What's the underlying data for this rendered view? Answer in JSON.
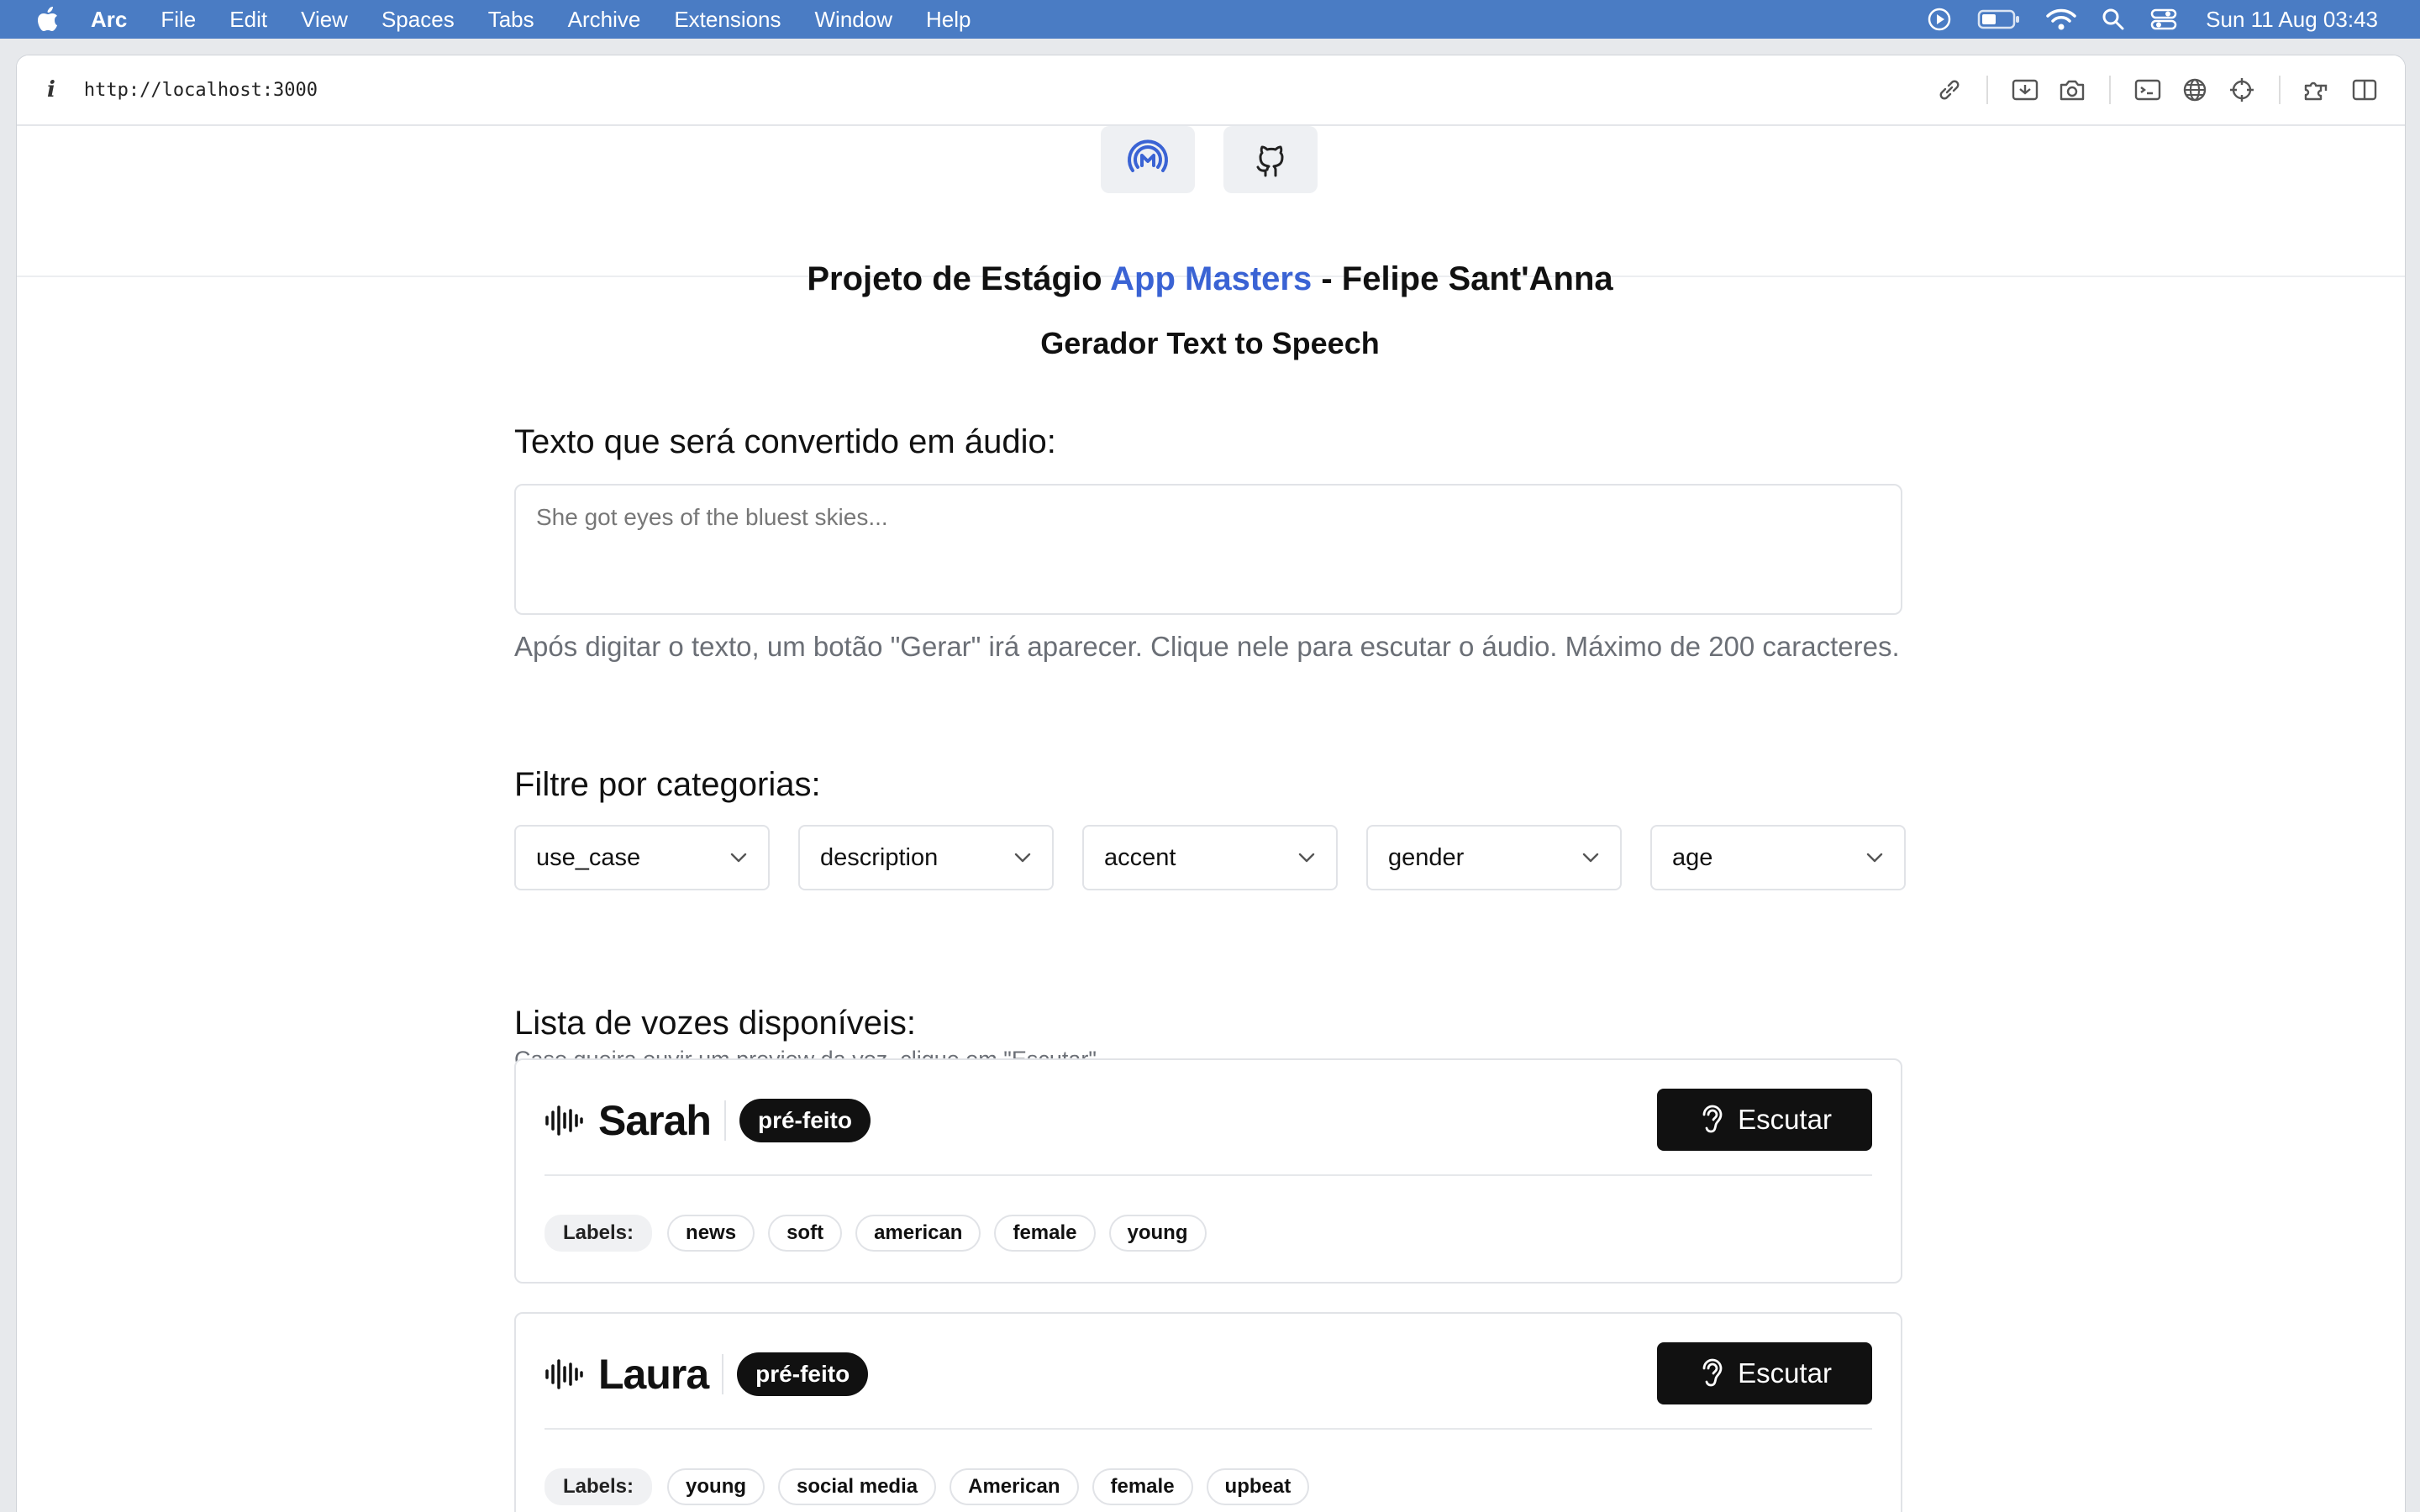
{
  "menubar": {
    "app": "Arc",
    "items": [
      "File",
      "Edit",
      "View",
      "Spaces",
      "Tabs",
      "Archive",
      "Extensions",
      "Window",
      "Help"
    ],
    "clock": "Sun 11 Aug  03:43"
  },
  "browser": {
    "info_icon": "i",
    "url": "http://localhost:3000"
  },
  "page": {
    "title_prefix": "Projeto de Estágio ",
    "title_brand": "App Masters",
    "title_suffix": " - Felipe Sant'Anna",
    "subtitle": "Gerador Text to Speech",
    "text_section": "Texto que será convertido em áudio:",
    "textarea_placeholder": "She got eyes of the bluest skies...",
    "hint": "Após digitar o texto, um botão \"Gerar\" irá aparecer. Clique nele para escutar o áudio. Máximo de 200 caracteres.",
    "filter_section": "Filtre por categorias:",
    "filters": [
      "use_case",
      "description",
      "accent",
      "gender",
      "age"
    ],
    "list_section": "Lista de vozes disponíveis:",
    "list_sub": "Caso queira ouvir um preview da voz, clique em \"Escutar\".",
    "labels_title": "Labels:",
    "listen_label": "Escutar",
    "voices": [
      {
        "name": "Sarah",
        "badge": "pré-feito",
        "labels": [
          "news",
          "soft",
          "american",
          "female",
          "young"
        ]
      },
      {
        "name": "Laura",
        "badge": "pré-feito",
        "labels": [
          "young",
          "social media",
          "American",
          "female",
          "upbeat"
        ]
      }
    ]
  },
  "colors": {
    "brand": "#3a63d4",
    "menubar": "#4a7cc4",
    "button": "#111111"
  }
}
